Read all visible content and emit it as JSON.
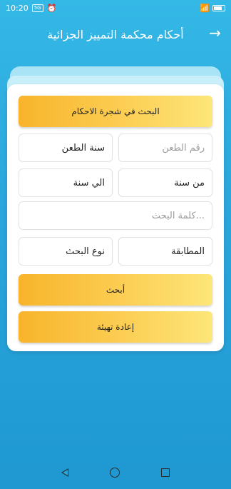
{
  "status_bar": {
    "time": "10:20",
    "badge": "5G",
    "battery_icon": "battery-icon"
  },
  "app_bar": {
    "title": "أحكام محكمة التمييز الجزائية",
    "back_icon": "arrow-right-icon"
  },
  "form": {
    "tree_button": "البحث في شجرة الاحكام",
    "appeal_number_placeholder": "رقم الطعن",
    "appeal_year": "سنة الطعن",
    "from_year": "من سنة",
    "to_year": "الي سنة",
    "search_word_placeholder": "كلمة البحث...",
    "match_type": "المطابقة",
    "search_type": "نوع البحث",
    "search_button": "أبحث",
    "reset_button": "إعادة تهيئة"
  },
  "colors": {
    "gold_start": "#f8b42b",
    "gold_end": "#fde67a",
    "background": "#2aa7dc"
  }
}
